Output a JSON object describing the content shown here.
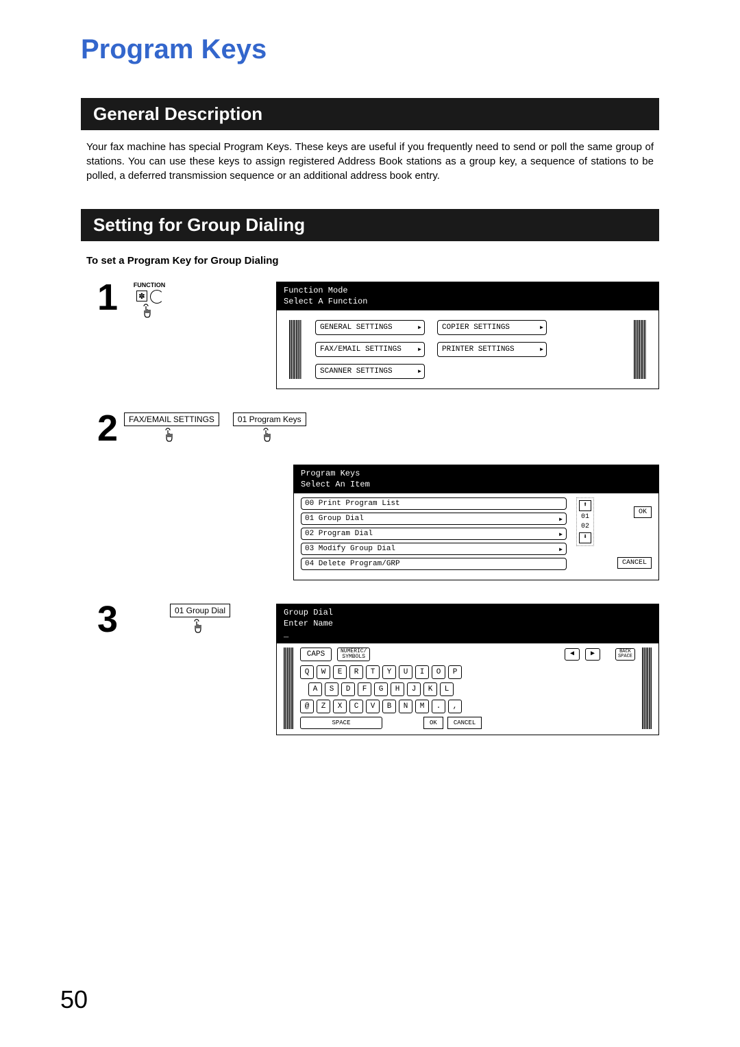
{
  "title": "Program Keys",
  "section1_title": "General Description",
  "desc_text": "Your fax machine has special Program Keys. These keys are useful if you frequently need to send or poll the same group of stations. You can use these keys to assign registered Address Book stations as a group key, a sequence of stations to be polled, a deferred transmission sequence or an additional address book entry.",
  "section2_title": "Setting for Group Dialing",
  "subheading": "To set a Program Key for Group Dialing",
  "steps": {
    "s1": "1",
    "s2": "2",
    "s3": "3"
  },
  "step1": {
    "fn_label": "FUNCTION",
    "asterisk": "✽",
    "panel_title": "Function Mode",
    "panel_sub": "Select A Function",
    "btns": {
      "general": "GENERAL SETTINGS",
      "copier": "COPIER SETTINGS",
      "faxemail": "FAX/EMAIL SETTINGS",
      "printer": "PRINTER SETTINGS",
      "scanner": "SCANNER SETTINGS"
    }
  },
  "step2": {
    "left_btn": "FAX/EMAIL SETTINGS",
    "right_btn": "01 Program Keys",
    "panel_title": "Program Keys",
    "panel_sub": "Select An Item",
    "items": {
      "i0": "00  Print Program List",
      "i1": "01  Group Dial",
      "i2": "02  Program Dial",
      "i3": "03  Modify Group Dial",
      "i4": "04  Delete Program/GRP"
    },
    "scroll_top_num": "01",
    "scroll_bot_num": "02",
    "ok": "OK",
    "cancel": "CANCEL"
  },
  "step3": {
    "left_btn": "01 Group Dial",
    "panel_title": "Group Dial",
    "panel_sub": "Enter Name",
    "caps": "CAPS",
    "numsym_top": "NUMERIC/",
    "numsym_bot": "SYMBOLS",
    "backspace_top": "BACK",
    "backspace_bot": "SPACE",
    "row1": [
      "Q",
      "W",
      "E",
      "R",
      "T",
      "Y",
      "U",
      "I",
      "O",
      "P"
    ],
    "row2": [
      "A",
      "S",
      "D",
      "F",
      "G",
      "H",
      "J",
      "K",
      "L"
    ],
    "row3": [
      "@",
      "Z",
      "X",
      "C",
      "V",
      "B",
      "N",
      "M",
      ".",
      ","
    ],
    "space": "SPACE",
    "ok": "OK",
    "cancel": "CANCEL"
  },
  "page_number": "50"
}
